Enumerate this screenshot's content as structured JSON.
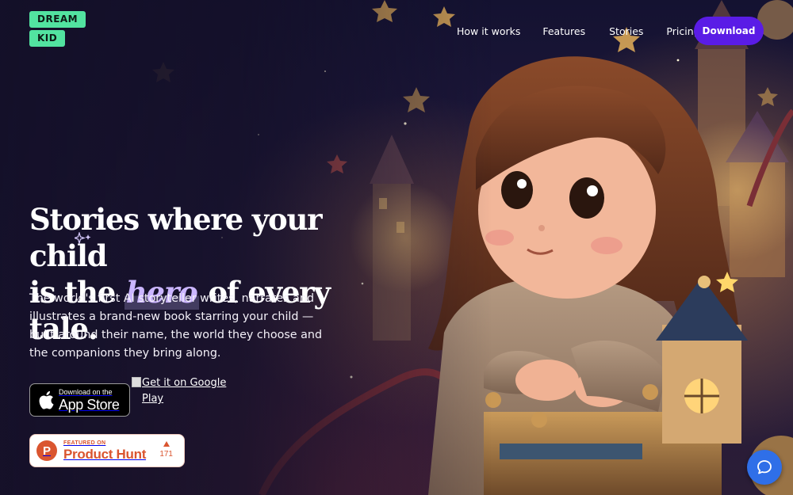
{
  "brand": {
    "line1": "DREAM",
    "line2": "KID",
    "accent": "#52e3a0"
  },
  "nav": {
    "items": [
      {
        "label": "How it works"
      },
      {
        "label": "Features"
      },
      {
        "label": "Stories"
      },
      {
        "label": "Pricing"
      }
    ],
    "cta_label": "Download",
    "cta_color": "#5a1ce6"
  },
  "hero": {
    "headline_line1": "Stories where your child",
    "headline_pre": "is the",
    "headline_emphasis": "hero",
    "headline_post": "of every tale.",
    "subtitle": "The world's first AI storyteller writes, narrates and illustrates a brand-new book starring your child — built around their name, the world they choose and the companions they bring along."
  },
  "badges": {
    "appstore": {
      "small": "Download on the",
      "big": "App Store",
      "icon": "apple-icon"
    },
    "googleplay": {
      "alt_text": "Get it on Google Play"
    },
    "producthunt": {
      "small": "FEATURED ON",
      "big": "Product Hunt",
      "votes": "171",
      "logo_letter": "P",
      "color": "#da552f"
    }
  },
  "chat": {
    "icon": "chat-bubble-icon",
    "color": "#2f6fe8"
  }
}
